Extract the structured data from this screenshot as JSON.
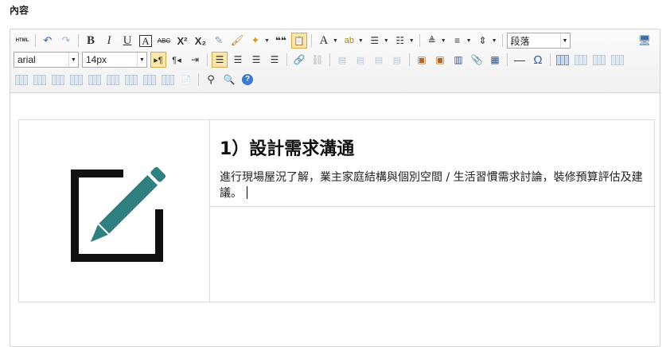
{
  "field_label": "內容",
  "toolbar": {
    "html_button": "HTML",
    "bold": "B",
    "italic": "I",
    "underline": "U",
    "frame_text": "A",
    "strike": "ABC",
    "superscript": "X²",
    "subscript": "X₂",
    "quote": "❝❝",
    "font_color": "A",
    "font_family": "arial",
    "font_size": "14px",
    "paragraph_format": "段落",
    "omega": "Ω",
    "help": "?"
  },
  "content": {
    "heading": "1）設計需求溝通",
    "paragraph": "進行現場屋況了解，業主家庭結構與個別空間 / 生活習慣需求討論，裝修預算評估及建議。"
  },
  "colors": {
    "icon_teal": "#2f8080",
    "icon_black": "#111111",
    "active_bg": "#fce6a8"
  }
}
